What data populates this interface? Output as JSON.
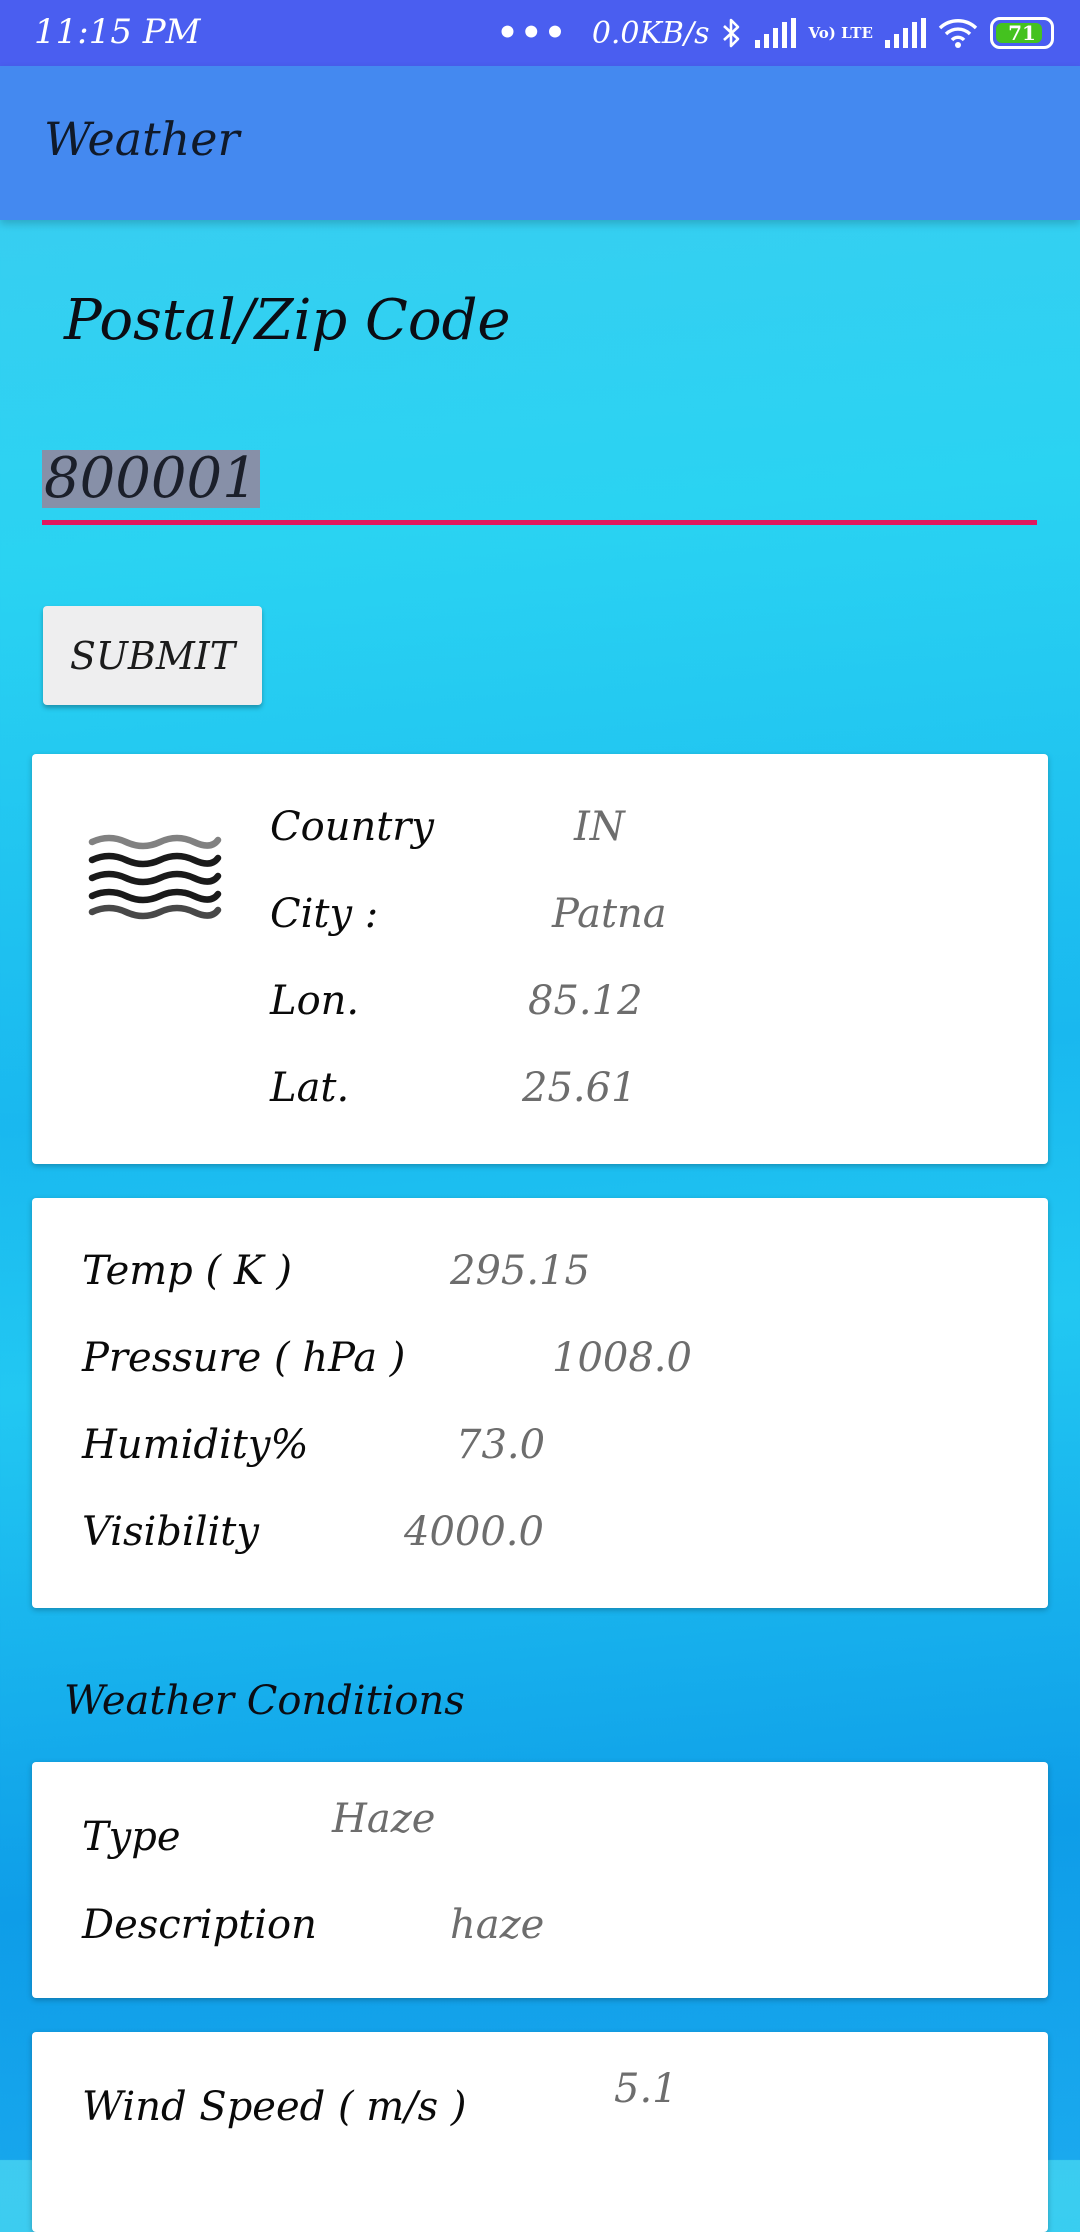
{
  "status_bar": {
    "time": "11:15 PM",
    "dots": "•••",
    "network_speed": "0.0KB/s",
    "volte": "Vo) LTE",
    "battery": "71"
  },
  "app_bar": {
    "title": "Weather"
  },
  "zip_form": {
    "label": "Postal/Zip Code",
    "value": "800001",
    "submit_label": "SUBMIT"
  },
  "location_card": {
    "icon": "haze-icon",
    "rows": [
      {
        "label": "Country",
        "value": "IN"
      },
      {
        "label": "City  :",
        "value": "Patna"
      },
      {
        "label": "Lon.",
        "value": "85.12"
      },
      {
        "label": "Lat.",
        "value": "25.61"
      }
    ]
  },
  "measure_card": {
    "rows": [
      {
        "label": "Temp ( K )",
        "value": "295.15"
      },
      {
        "label": "Pressure ( hPa )",
        "value": "1008.0"
      },
      {
        "label": "Humidity%",
        "value": "73.0"
      },
      {
        "label": "Visibility",
        "value": "4000.0"
      }
    ]
  },
  "conditions": {
    "title": "Weather Conditions",
    "rows": [
      {
        "label": "Type",
        "value": "Haze"
      },
      {
        "label": "Description",
        "value": "haze"
      }
    ]
  },
  "wind_card": {
    "rows": [
      {
        "label": "Wind Speed ( m/s )",
        "value": "5.1"
      }
    ]
  },
  "colors": {
    "status_bar": "#4a5ef0",
    "app_bar": "#4489f0",
    "input_underline": "#e0185f",
    "selection": "#8790a8",
    "battery": "#44c21f"
  }
}
